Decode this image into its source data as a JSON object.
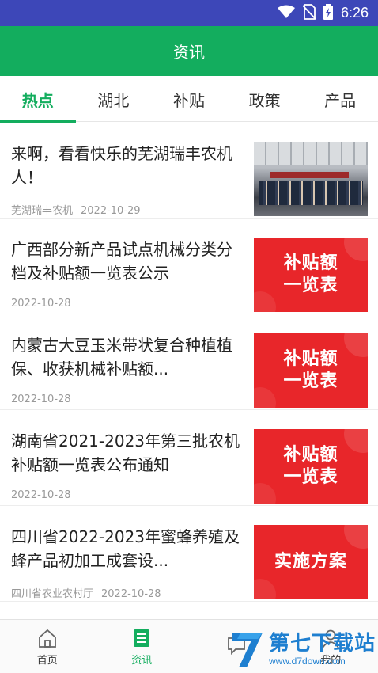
{
  "status_bar": {
    "time": "6:26"
  },
  "header": {
    "title": "资讯"
  },
  "tabs": [
    {
      "label": "热点",
      "active": true
    },
    {
      "label": "湖北",
      "active": false
    },
    {
      "label": "补贴",
      "active": false
    },
    {
      "label": "政策",
      "active": false
    },
    {
      "label": "产品",
      "active": false
    }
  ],
  "news": [
    {
      "title": "来啊，看看快乐的芜湖瑞丰农机人！",
      "source": "芜湖瑞丰农机",
      "date": "2022-10-29",
      "thumb_type": "photo"
    },
    {
      "title": "广西部分新产品试点机械分类分档及补贴额一览表公示",
      "source": "",
      "date": "2022-10-28",
      "thumb_type": "red",
      "thumb_lines": [
        "补贴额",
        "一览表"
      ]
    },
    {
      "title": "内蒙古大豆玉米带状复合种植植保、收获机械补贴额...",
      "source": "",
      "date": "2022-10-28",
      "thumb_type": "red",
      "thumb_lines": [
        "补贴额",
        "一览表"
      ]
    },
    {
      "title": "湖南省2021-2023年第三批农机补贴额一览表公布通知",
      "source": "",
      "date": "2022-10-28",
      "thumb_type": "red",
      "thumb_lines": [
        "补贴额",
        "一览表"
      ]
    },
    {
      "title": "四川省2022-2023年蜜蜂养殖及蜂产品初加工成套设...",
      "source": "四川省农业农村厅",
      "date": "2022-10-28",
      "thumb_type": "red",
      "thumb_lines": [
        "实施方案"
      ]
    }
  ],
  "bottom_nav": [
    {
      "label": "首页",
      "icon": "home-icon",
      "active": false
    },
    {
      "label": "资讯",
      "icon": "news-icon",
      "active": true
    },
    {
      "label": "",
      "icon": "message-icon",
      "active": false
    },
    {
      "label": "我的",
      "icon": "profile-icon",
      "active": false
    }
  ],
  "watermark": {
    "text": "第七下载站",
    "url": "www.d7down.com"
  },
  "colors": {
    "status_bar": "#3d47b8",
    "brand_green": "#13ad5e",
    "thumb_red": "#e8262a",
    "watermark_blue": "#1e7fd0"
  }
}
